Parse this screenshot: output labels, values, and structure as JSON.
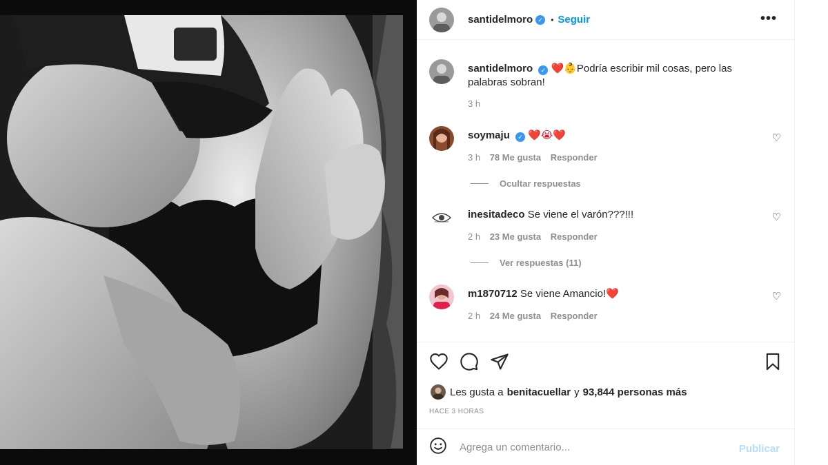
{
  "post": {
    "author": "santidelmoro",
    "verified": true,
    "follow_label": "Seguir",
    "separator": "•",
    "more_label": "•••",
    "photo_alt": "black and white photo",
    "caption": {
      "username": "santidelmoro",
      "text": "Podría escribir mil cosas, pero las palabras sobran!",
      "emoji": "❤️👶",
      "time": "3 h"
    }
  },
  "comments": [
    {
      "username": "soymaju",
      "verified": true,
      "text": "",
      "emoji": "❤️😭❤️",
      "time": "3 h",
      "likes": "78 Me gusta",
      "reply_label": "Responder",
      "replies_toggle": "Ocultar respuestas"
    },
    {
      "username": "inesitadeco",
      "verified": false,
      "text": "Se viene el varón???!!!",
      "emoji": "",
      "time": "2 h",
      "likes": "23 Me gusta",
      "reply_label": "Responder",
      "replies_toggle": "Ver respuestas (11)"
    },
    {
      "username": "m1870712",
      "verified": false,
      "text": "Se viene Amancio!",
      "emoji": "❤️",
      "time": "2 h",
      "likes": "24 Me gusta",
      "reply_label": "Responder",
      "replies_toggle": ""
    }
  ],
  "actions": {
    "icons": [
      "heart-outline-icon",
      "comment-icon",
      "share-icon",
      "bookmark-icon"
    ]
  },
  "likes": {
    "prefix": "Les gusta a",
    "user": "benitacuellar",
    "connector": "y",
    "others": "93,844 personas más"
  },
  "time_ago": "HACE 3 HORAS",
  "comment_box": {
    "placeholder": "Agrega un comentario...",
    "publish_label": "Publicar",
    "emoji_icon": "smiley-icon"
  },
  "colors": {
    "accent": "#0095f6",
    "publish_disabled": "#b2dffc",
    "muted": "#8e8e8e",
    "text": "#262626",
    "verified": "#3897f0",
    "heart_red": "#e0162b"
  }
}
